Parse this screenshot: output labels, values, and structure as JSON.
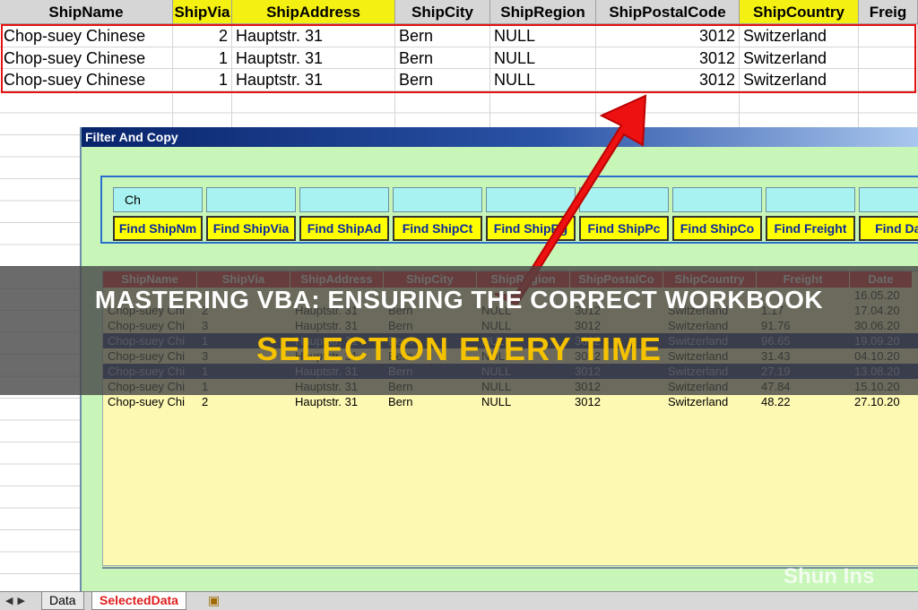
{
  "sheet": {
    "headers": [
      "ShipName",
      "ShipVia",
      "ShipAddress",
      "ShipCity",
      "ShipRegion",
      "ShipPostalCode",
      "ShipCountry",
      "Freig"
    ],
    "rows": [
      [
        "Chop-suey Chinese",
        "2",
        "Hauptstr. 31",
        "Bern",
        "NULL",
        "3012",
        "Switzerland",
        ""
      ],
      [
        "Chop-suey Chinese",
        "1",
        "Hauptstr. 31",
        "Bern",
        "NULL",
        "3012",
        "Switzerland",
        ""
      ],
      [
        "Chop-suey Chinese",
        "1",
        "Hauptstr. 31",
        "Bern",
        "NULL",
        "3012",
        "Switzerland",
        ""
      ]
    ]
  },
  "form": {
    "title": "Filter And Copy",
    "inputs": [
      "Ch",
      "",
      "",
      "",
      "",
      "",
      "",
      "",
      ""
    ],
    "buttons": [
      "Find ShipNm",
      "Find ShipVia",
      "Find ShipAd",
      "Find ShipCt",
      "Find ShipRg",
      "Find ShipPc",
      "Find ShipCo",
      "Find Freight",
      "Find Date"
    ],
    "list_headers": [
      "ShipName",
      "ShipVia",
      "ShipAddress",
      "ShipCity",
      "ShipRegion",
      "ShipPostalCo",
      "ShipCountry",
      "Freight",
      "Date"
    ],
    "list_rows": [
      [
        "",
        "",
        "",
        "",
        "",
        "",
        "",
        "",
        "16.05.20"
      ],
      [
        "Chop-suey Chi",
        "2",
        "Hauptstr. 31",
        "Bern",
        "NULL",
        "3012",
        "Switzerland",
        "1.17",
        "17.04.20"
      ],
      [
        "Chop-suey Chi",
        "3",
        "Hauptstr. 31",
        "Bern",
        "NULL",
        "3012",
        "Switzerland",
        "91.76",
        "30.06.20"
      ],
      [
        "Chop-suey Chi",
        "1",
        "Hauptstr. 31",
        "Bern",
        "NULL",
        "3012",
        "Switzerland",
        "96.65",
        "19.09.20"
      ],
      [
        "Chop-suey Chi",
        "3",
        "Hauptstr. 31",
        "Bern",
        "NULL",
        "3012",
        "Switzerland",
        "31.43",
        "04.10.20"
      ],
      [
        "Chop-suey Chi",
        "1",
        "Hauptstr. 31",
        "Bern",
        "NULL",
        "3012",
        "Switzerland",
        "27.19",
        "13.08.20"
      ],
      [
        "Chop-suey Chi",
        "1",
        "Hauptstr. 31",
        "Bern",
        "NULL",
        "3012",
        "Switzerland",
        "47.84",
        "15.10.20"
      ],
      [
        "Chop-suey Chi",
        "2",
        "Hauptstr. 31",
        "Bern",
        "NULL",
        "3012",
        "Switzerland",
        "48.22",
        "27.10.20"
      ]
    ],
    "selected_rows": [
      3,
      5
    ]
  },
  "tabs": {
    "nav": "◀ ▶",
    "items": [
      {
        "label": "Data",
        "active": false
      },
      {
        "label": "SelectedData",
        "active": true
      }
    ]
  },
  "banner": {
    "line1": "MASTERING VBA: ENSURING THE CORRECT WORKBOOK",
    "line2": "SELECTION EVERY TIME"
  },
  "watermark": "Shun Ins",
  "colors": {
    "highlight_red": "#e51212",
    "header_yellow": "#f4f012",
    "form_green": "#c8f5b8",
    "list_yellow": "#fdf8b2"
  },
  "icons": {
    "new_sheet": "new-sheet-icon"
  }
}
